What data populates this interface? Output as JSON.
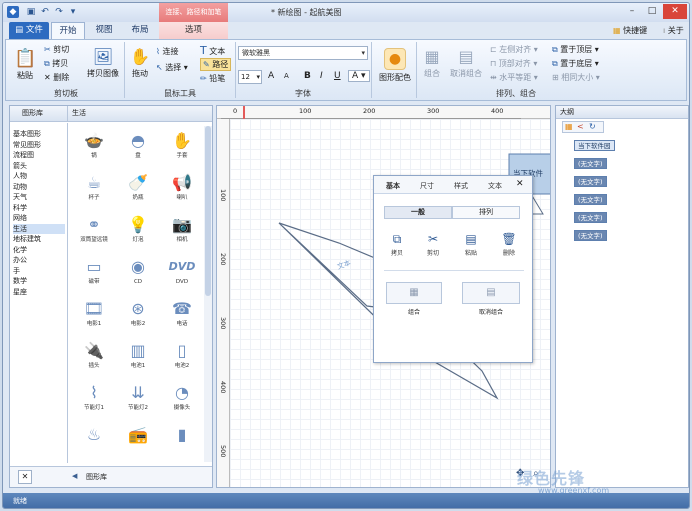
{
  "titlebar": {
    "title": "* 新绘图 - 起航美图",
    "context_group": "连接、路径和加笔"
  },
  "tabs": [
    "文件",
    "开始",
    "视图",
    "布局",
    "选项"
  ],
  "top_right": {
    "shortcut": "快捷键",
    "about": "关于"
  },
  "ribbon": {
    "clipboard": {
      "label": "剪切板",
      "paste": "粘贴",
      "cut": "剪切",
      "copy": "拷贝",
      "delete": "删除",
      "format_painter": "拷贝图像"
    },
    "mouse_tools": {
      "label": "鼠标工具",
      "drag": "拖动",
      "connect": "连接",
      "select": "选择",
      "text": "文本",
      "path": "路径",
      "pencil": "铅笔"
    },
    "font": {
      "label": "字体",
      "font_name": "微软雅黑",
      "font_size": "12",
      "bold": "B",
      "italic": "I",
      "underline": "U",
      "grow": "A",
      "shrink": "A",
      "color": "A"
    },
    "shape_color": {
      "label": "图形配色"
    },
    "arrange": {
      "label": "排列、组合",
      "group": "组合",
      "ungroup": "取消组合",
      "align_left": "左侧对齐",
      "align_top": "顶部对齐",
      "h_distribute": "水平等距",
      "bring_top": "置于顶层",
      "send_bottom": "置于底层",
      "same_size": "相同大小"
    }
  },
  "left_panel": {
    "header_lib": "图形库",
    "header_cat": "生活",
    "categories": [
      "基本图形",
      "常见图形",
      "流程图",
      "箭头",
      "人物",
      "动物",
      "天气",
      "科学",
      "网络",
      "生活",
      "地标建筑",
      "化学",
      "办公",
      "手",
      "数学",
      "星座"
    ],
    "selected_category": "生活",
    "shapes": [
      "锅",
      "盘",
      "手套",
      "杯子",
      "奶瓶",
      "喇叭",
      "双筒望远镜",
      "灯泡",
      "相机",
      "磁带",
      "CD",
      "DVD",
      "电影1",
      "电影2",
      "电话",
      "插头",
      "电池1",
      "电池2",
      "节能灯1",
      "节能灯2",
      "摄像头",
      "",
      "",
      ""
    ],
    "footer_lib": "图形库",
    "close_glyph": "✕",
    "back_glyph": "◀"
  },
  "ruler": {
    "h": [
      "0",
      "100",
      "200",
      "300",
      "400"
    ],
    "v": [
      "100",
      "200",
      "300",
      "400",
      "500"
    ]
  },
  "canvas": {
    "shape_text": "当下软件",
    "handle_text": "文本"
  },
  "dialog": {
    "tabs": [
      "基本",
      "尺寸",
      "样式",
      "文本"
    ],
    "close": "✕",
    "subtabs": [
      "一般",
      "排列"
    ],
    "buttons": [
      "拷贝",
      "剪切",
      "粘贴",
      "删除"
    ],
    "wide_buttons": [
      "组合",
      "取消组合"
    ]
  },
  "right_panel": {
    "title": "大纲",
    "items": [
      "当下软件园",
      "(无文字)",
      "(无文字)",
      "(无文字)",
      "(无文字)",
      "(无文字)"
    ]
  },
  "status": {
    "text": "就绪"
  },
  "watermark": {
    "brand": "绿色先锋",
    "url": "www.greenxf.com"
  }
}
